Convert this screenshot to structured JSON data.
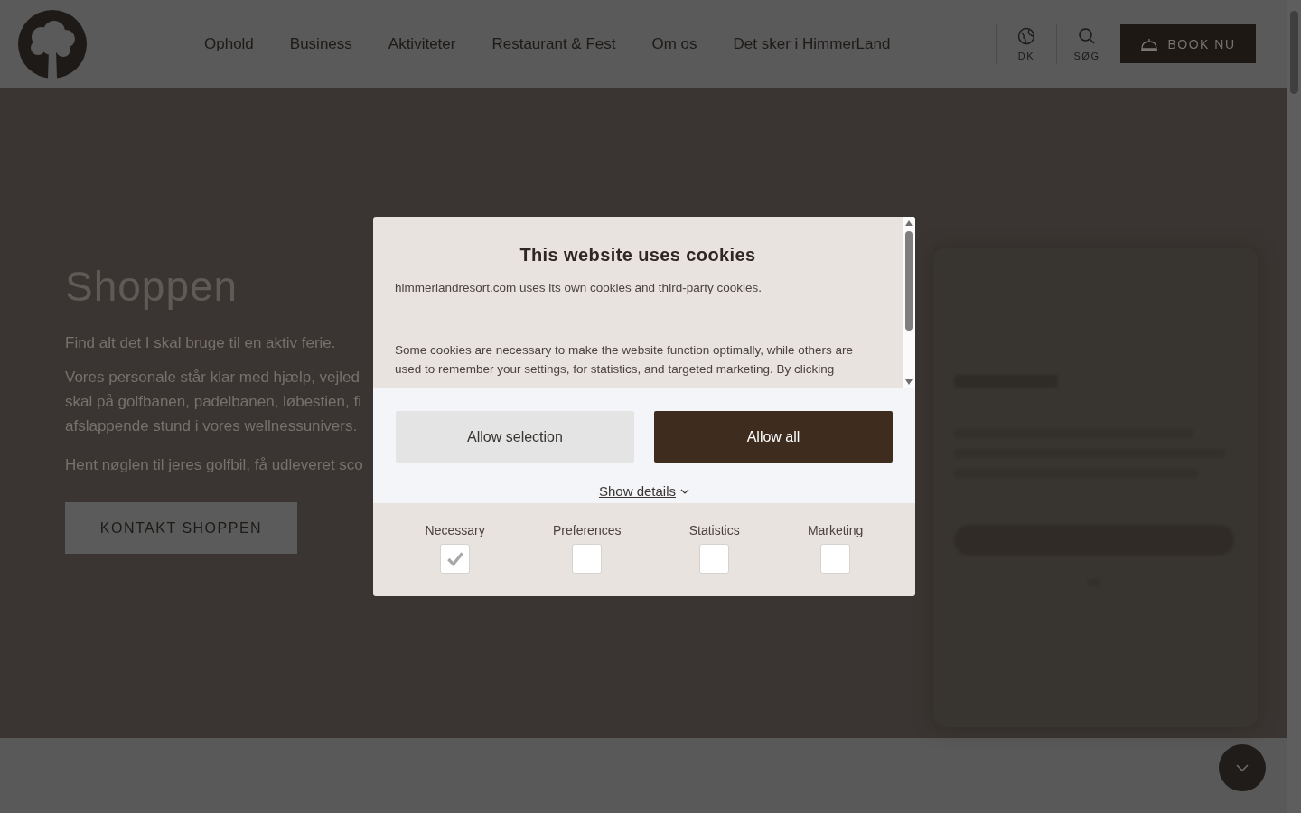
{
  "header": {
    "nav": [
      {
        "label": "Ophold"
      },
      {
        "label": "Business"
      },
      {
        "label": "Aktiviteter"
      },
      {
        "label": "Restaurant & Fest"
      },
      {
        "label": "Om os"
      },
      {
        "label": "Det sker i HimmerLand"
      }
    ],
    "language": {
      "label": "DK"
    },
    "search": {
      "label": "SØG"
    },
    "book": {
      "label": "BOOK NU"
    }
  },
  "hero": {
    "title": "Shoppen",
    "lead": "Find alt det I skal bruge til en aktiv ferie.",
    "paragraph_lines": [
      "Vores personale står klar med hjælp, vejled",
      "skal på golfbanen, padelbanen, løbestien, fi",
      "afslappende stund i vores wellnessunivers."
    ],
    "paragraph_2": "Hent nøglen til jeres golfbil, få udleveret sco",
    "button": "KONTAKT SHOPPEN"
  },
  "cookie_dialog": {
    "title": "This website uses cookies",
    "intro": "himmerlandresort.com uses its own cookies and third-party cookies.",
    "body": "Some cookies are necessary to make the website function optimally, while others are used to remember your settings, for statistics, and targeted marketing. By clicking",
    "buttons": [
      {
        "label": "Allow selection",
        "kind": "secondary"
      },
      {
        "label": "Allow all",
        "kind": "primary"
      }
    ],
    "show_details": "Show details",
    "categories": [
      {
        "label": "Necessary",
        "checked": true
      },
      {
        "label": "Preferences",
        "checked": false
      },
      {
        "label": "Statistics",
        "checked": false
      },
      {
        "label": "Marketing",
        "checked": false
      }
    ]
  }
}
